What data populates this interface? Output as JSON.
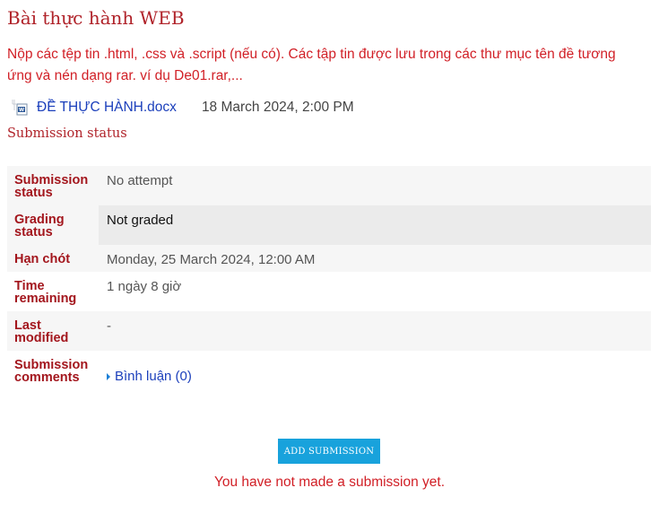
{
  "assignment": {
    "title": "Bài thực hành WEB",
    "intro_lines": [
      "Nộp các tệp tin .html, .css và .script (nếu có). Các tập tin được lưu trong các thư mục tên đề tương",
      "ứng và nén dạng rar. ví dụ De01.rar,..."
    ],
    "attachment": {
      "icon": "word-document-icon",
      "name": "ĐỀ THỰC HÀNH.docx",
      "date": "18 March 2024, 2:00 PM"
    }
  },
  "submission_section": {
    "heading": "Submission status",
    "rows": [
      {
        "label": "Submission status",
        "value": "No attempt"
      },
      {
        "label": "Grading status",
        "value": "Not graded"
      },
      {
        "label": "Hạn chót",
        "value": "Monday, 25 March 2024, 12:00 AM"
      },
      {
        "label": "Time remaining",
        "value": "1 ngày 8 giờ"
      },
      {
        "label": "Last modified",
        "value": "-"
      },
      {
        "label": "Submission comments",
        "toggle_icon": "caret-right-icon",
        "comments_link": "Bình luận (0)"
      }
    ]
  },
  "actions": {
    "add_submission_label": "Add submission",
    "no_submission_notice": "You have not made a submission yet."
  },
  "colors": {
    "heading_red": "#b0232a",
    "text_red": "#d11f26",
    "link_blue": "#1b3fbb",
    "button_blue": "#18a2dc"
  }
}
